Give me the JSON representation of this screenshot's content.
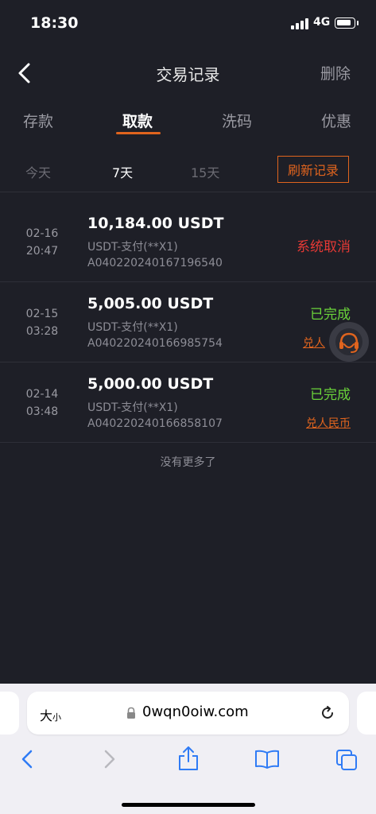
{
  "status": {
    "time": "18:30",
    "network": "4G"
  },
  "nav": {
    "title": "交易记录",
    "delete_label": "删除"
  },
  "tabs": [
    "存款",
    "取款",
    "洗码",
    "优惠"
  ],
  "filters": {
    "options": [
      "今天",
      "7天",
      "15天"
    ],
    "refresh_label": "刷新记录"
  },
  "records": [
    {
      "date": "02-16",
      "time": "20:47",
      "amount": "10,184.00 USDT",
      "method": "USDT-支付(**X1)",
      "order": "A040220240167196540",
      "status": "系统取消",
      "link": ""
    },
    {
      "date": "02-15",
      "time": "03:28",
      "amount": "5,005.00 USDT",
      "method": "USDT-支付(**X1)",
      "order": "A040220240166985754",
      "status": "已完成",
      "link": "兑人"
    },
    {
      "date": "02-14",
      "time": "03:48",
      "amount": "5,000.00 USDT",
      "method": "USDT-支付(**X1)",
      "order": "A040220240166858107",
      "status": "已完成",
      "link": "兑人民币"
    }
  ],
  "no_more": "没有更多了",
  "colors": {
    "accent": "#e0641e",
    "cancelled": "#e53935",
    "completed": "#6ad33a",
    "background": "#1e1f27"
  },
  "browser": {
    "text_size_big": "大",
    "text_size_small": "小",
    "url": "0wqn0oiw.com",
    "icons": [
      "back-icon",
      "forward-icon",
      "share-icon",
      "bookmarks-icon",
      "tabs-icon"
    ]
  }
}
